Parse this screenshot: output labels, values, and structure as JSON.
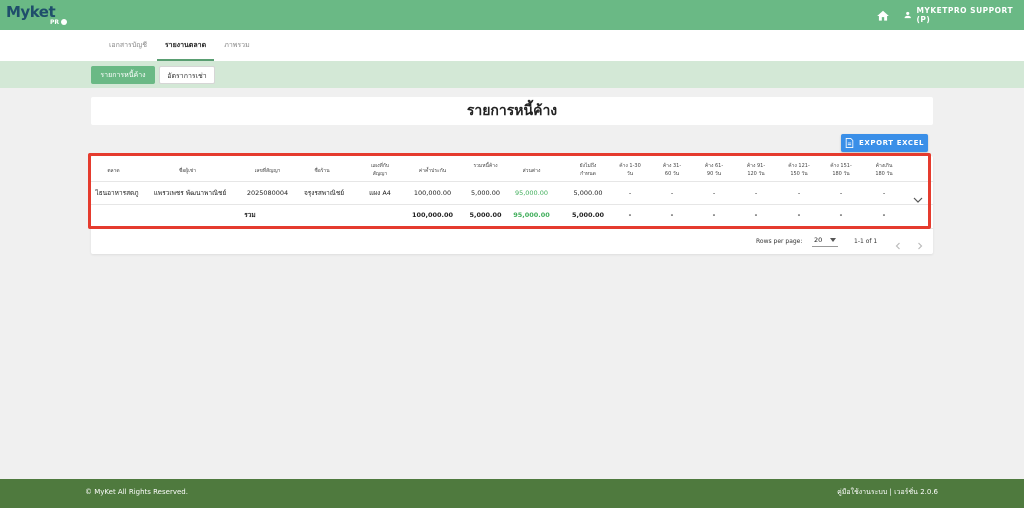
{
  "app": {
    "logo_text": "Myket",
    "logo_sub": "PR"
  },
  "header": {
    "user_label": "MYKETPRO SUPPORT (P)"
  },
  "tabs": [
    {
      "label": "เอกสารบัญชี"
    },
    {
      "label": "รายงานตลาด"
    },
    {
      "label": "ภาพรวม"
    }
  ],
  "subtabs": [
    {
      "label": "รายการหนี้ค้าง"
    },
    {
      "label": "อัตราการเช่า"
    }
  ],
  "page": {
    "title": "รายการหนี้ค้าง"
  },
  "toolbar": {
    "export_label": "EXPORT EXCEL"
  },
  "table": {
    "headers": {
      "market": "ตลาด",
      "tenant": "ชื่อผู้เช่า",
      "contract": "เลขที่สัญญา",
      "shop": "ชื่อร้าน",
      "zone_1": "แผงที่กับ",
      "zone_2": "สัญญา",
      "deposit": "ค่าค้ำประกัน",
      "total_debt": "รวมหนี้ค้าง",
      "diff": "ส่วนต่าง",
      "due_1": "ยังไม่ถึง",
      "due_2": "กำหนด",
      "a1": "ค้าง 1-30",
      "a1b": "วัน",
      "a2": "ค้าง 31-",
      "a2b": "60 วัน",
      "a3": "ค้าง 61-",
      "a3b": "90 วัน",
      "a4": "ค้าง 91-",
      "a4b": "120 วัน",
      "a5": "ค้าง 121-",
      "a5b": "150 วัน",
      "a6": "ค้าง 151-",
      "a6b": "180 วัน",
      "a7": "ค้างเกิน",
      "a7b": "180 วัน"
    },
    "row": {
      "market": "ไธนอาหารสดภู",
      "tenant": "แพรวเพชร พัฒนาพาณิชย์",
      "contract": "2025080004",
      "shop": "จรุงรสพาณิชย์",
      "zone": "แผง A4",
      "deposit": "100,000.00",
      "total_debt": "5,000.00",
      "diff": "95,000.00",
      "not_due": "5,000.00",
      "a1": "-",
      "a2": "-",
      "a3": "-",
      "a4": "-",
      "a5": "-",
      "a6": "-",
      "a7": "-"
    },
    "total": {
      "label": "รวม",
      "deposit": "100,000.00",
      "total_debt": "5,000.00",
      "diff": "95,000.00",
      "not_due": "5,000.00",
      "a1": "-",
      "a2": "-",
      "a3": "-",
      "a4": "-",
      "a5": "-",
      "a6": "-",
      "a7": "-"
    }
  },
  "pagination": {
    "rows_per_page_label": "Rows per page:",
    "rows_per_page": "20",
    "range": "1-1 of 1"
  },
  "footer": {
    "copyright": "© MyKet All Rights Reserved.",
    "manual_link": "คู่มือใช้งานระบบ",
    "separator": "|",
    "version": "เวอร์ชั่น 2.0.6"
  }
}
